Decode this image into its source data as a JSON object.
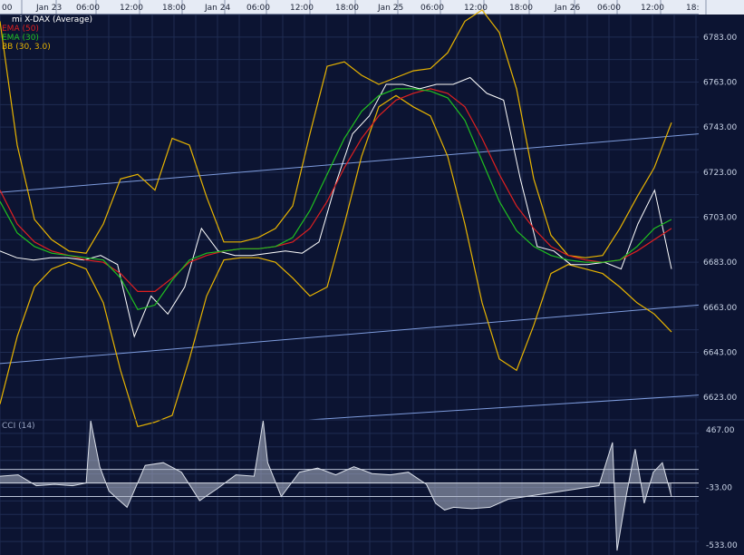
{
  "chart_data": [
    {
      "type": "line",
      "title": "mi X-DAX (Average)",
      "x_ticks": [
        "00",
        "Jan 23",
        "06:00",
        "12:00",
        "18:00",
        "Jan 24",
        "06:00",
        "12:00",
        "18:00",
        "Jan 25",
        "06:00",
        "12:00",
        "18:00",
        "Jan 26",
        "06:00",
        "12:00",
        "18:"
      ],
      "ylim": [
        6613,
        6793
      ],
      "y_ticks": [
        "6783.00",
        "6763.00",
        "6743.00",
        "6723.00",
        "6703.00",
        "6683.00",
        "6663.00",
        "6643.00",
        "6623.00"
      ],
      "legend": [
        {
          "label": "mi X-DAX (Average)",
          "color": "#ffffff"
        },
        {
          "label": "EMA (50)",
          "color": "#e02020"
        },
        {
          "label": "EMA (30)",
          "color": "#20c020"
        },
        {
          "label": "BB (30, 3.0)",
          "color": "#e8b400"
        }
      ],
      "x_index": [
        0,
        20,
        40,
        60,
        80,
        100,
        120,
        140,
        160,
        180,
        200,
        220,
        240,
        260,
        280,
        300,
        320,
        340,
        360,
        380,
        400,
        420,
        440,
        460,
        480,
        500,
        520,
        540,
        560,
        580,
        600,
        620,
        640,
        660,
        680,
        700,
        720,
        740
      ],
      "series": [
        {
          "name": "mi X-DAX (Average)",
          "color": "#ffffff",
          "values": [
            6688,
            6685,
            6684,
            6685,
            6685,
            6684,
            6686,
            6682,
            6650,
            6668,
            6660,
            6672,
            6698,
            6688,
            6686,
            6686,
            6687,
            6688,
            6687,
            6692,
            6718,
            6740,
            6748,
            6762,
            6762,
            6760,
            6762,
            6762,
            6765,
            6758,
            6755,
            6720,
            6690,
            6688,
            6682,
            6682,
            6683,
            6680,
            6700,
            6715,
            6680
          ]
        },
        {
          "name": "EMA (50)",
          "color": "#e02020",
          "values": [
            6715,
            6700,
            6692,
            6688,
            6686,
            6684,
            6683,
            6678,
            6670,
            6670,
            6676,
            6683,
            6686,
            6688,
            6689,
            6689,
            6690,
            6692,
            6698,
            6710,
            6725,
            6738,
            6748,
            6755,
            6758,
            6760,
            6758,
            6752,
            6738,
            6722,
            6708,
            6698,
            6690,
            6686,
            6684,
            6683,
            6684,
            6688,
            6693,
            6698
          ]
        },
        {
          "name": "EMA (30)",
          "color": "#20c020",
          "values": [
            6710,
            6696,
            6690,
            6687,
            6686,
            6685,
            6684,
            6676,
            6662,
            6664,
            6675,
            6684,
            6687,
            6688,
            6689,
            6689,
            6690,
            6694,
            6706,
            6722,
            6738,
            6750,
            6757,
            6760,
            6760,
            6759,
            6756,
            6746,
            6728,
            6710,
            6697,
            6690,
            6686,
            6684,
            6683,
            6683,
            6684,
            6690,
            6698,
            6702
          ]
        },
        {
          "name": "BB upper",
          "color": "#e8b400",
          "values": [
            6790,
            6735,
            6702,
            6693,
            6688,
            6687,
            6700,
            6720,
            6722,
            6715,
            6738,
            6735,
            6712,
            6692,
            6692,
            6694,
            6698,
            6708,
            6740,
            6770,
            6772,
            6766,
            6762,
            6765,
            6768,
            6769,
            6776,
            6790,
            6795,
            6785,
            6760,
            6720,
            6695,
            6686,
            6685,
            6686,
            6698,
            6712,
            6725,
            6745
          ]
        },
        {
          "name": "BB lower",
          "color": "#e8b400",
          "values": [
            6620,
            6650,
            6672,
            6680,
            6683,
            6680,
            6665,
            6635,
            6610,
            6612,
            6615,
            6640,
            6668,
            6684,
            6685,
            6685,
            6683,
            6676,
            6668,
            6672,
            6700,
            6730,
            6752,
            6757,
            6752,
            6748,
            6730,
            6700,
            6665,
            6640,
            6635,
            6655,
            6678,
            6682,
            6680,
            6678,
            6672,
            6665,
            6660,
            6652
          ]
        }
      ],
      "trendlines": [
        {
          "name": "upper-channel",
          "from": [
            0,
            6714
          ],
          "to": [
            770,
            6740
          ]
        },
        {
          "name": "middle-channel",
          "from": [
            0,
            6638
          ],
          "to": [
            770,
            6664
          ]
        },
        {
          "name": "lower-channel",
          "from": [
            340,
            6613
          ],
          "to": [
            770,
            6624
          ]
        }
      ],
      "grid": true,
      "legend_position": "top-left"
    },
    {
      "type": "area",
      "title": "CCI (14)",
      "y_ticks": [
        "467.00",
        "-33.00",
        "-533.00"
      ],
      "ylim": [
        -533,
        467
      ],
      "reference_lines": [
        100,
        -100
      ],
      "x_index": [
        0,
        20,
        40,
        60,
        80,
        95,
        100,
        110,
        120,
        130,
        140,
        160,
        180,
        200,
        220,
        240,
        260,
        280,
        290,
        295,
        310,
        330,
        350,
        370,
        390,
        410,
        430,
        450,
        470,
        480,
        490,
        500,
        520,
        540,
        560,
        580,
        600,
        620,
        640,
        660,
        675,
        680,
        690,
        700,
        710,
        720,
        730,
        740
      ],
      "values": [
        50,
        60,
        -20,
        -10,
        -20,
        0,
        460,
        120,
        -60,
        -120,
        -180,
        130,
        150,
        80,
        -130,
        -40,
        60,
        50,
        460,
        150,
        -100,
        80,
        110,
        60,
        120,
        70,
        60,
        80,
        -10,
        -150,
        -200,
        -180,
        -190,
        -180,
        -120,
        -100,
        -80,
        -60,
        -40,
        -20,
        300,
        -500,
        -100,
        250,
        -150,
        80,
        150,
        -100
      ],
      "color": "#d9dee8",
      "legend_position": "top-left"
    }
  ]
}
